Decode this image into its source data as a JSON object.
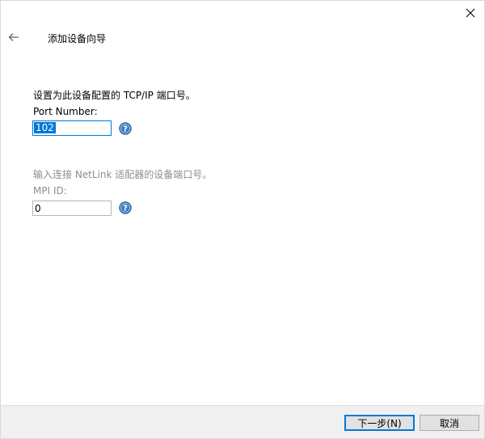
{
  "window": {
    "title": "添加设备向导"
  },
  "icons": {
    "close": "close-icon",
    "back": "back-arrow-icon",
    "help": "help-question-icon"
  },
  "tcp": {
    "description": "设置为此设备配置的 TCP/IP 端口号。",
    "port_label": "Port Number:",
    "port_value": "102"
  },
  "netlink": {
    "description": "输入连接 NetLink 适配器的设备端口号。",
    "mpi_label": "MPI ID:",
    "mpi_value": "0"
  },
  "footer": {
    "next_label": "下一步(N)",
    "cancel_label": "取消"
  },
  "colors": {
    "accent": "#0078d7",
    "help_icon": "#3a7fc1",
    "disabled_text": "#8d8d8d",
    "footer_bg": "#f0f0f0",
    "button_bg": "#e1e1e1"
  }
}
